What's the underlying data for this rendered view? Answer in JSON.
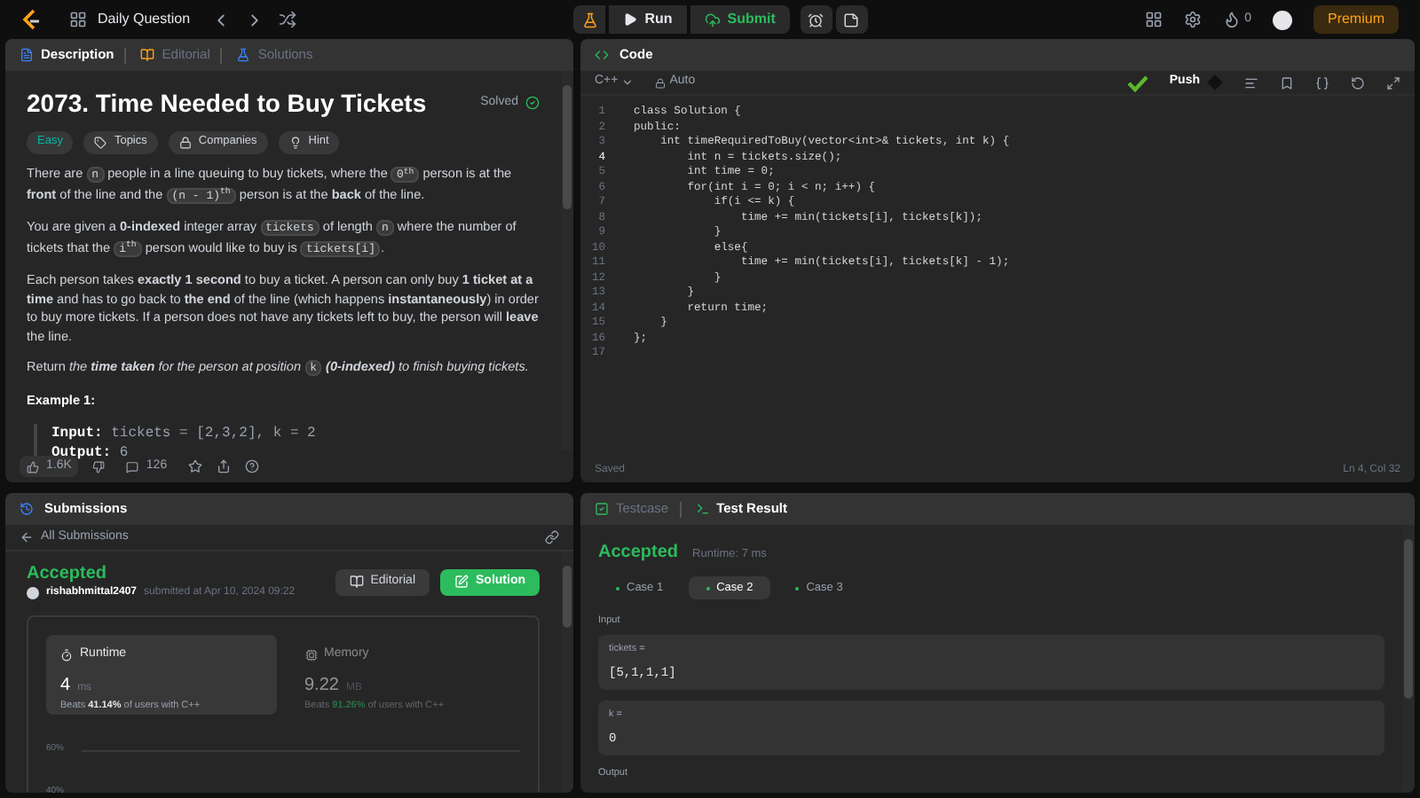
{
  "topbar": {
    "title": "Daily Question",
    "run": "Run",
    "submit": "Submit",
    "streak": "0",
    "premium": "Premium"
  },
  "description": {
    "tabs": [
      {
        "label": "Description",
        "selected": true
      },
      {
        "label": "Editorial",
        "selected": false
      },
      {
        "label": "Solutions",
        "selected": false
      }
    ],
    "title": "2073. Time Needed to Buy Tickets",
    "status": "Solved",
    "chips": [
      {
        "label": "Easy",
        "kind": "difficulty"
      },
      {
        "label": "Topics",
        "kind": "tag"
      },
      {
        "label": "Companies",
        "kind": "lock"
      },
      {
        "label": "Hint",
        "kind": "bulb"
      }
    ],
    "paragraphs": [
      [
        {
          "kind": "text",
          "text": "There are "
        },
        {
          "kind": "code",
          "text": "n"
        },
        {
          "kind": "text",
          "text": " people in a line queuing to buy tickets, where the "
        },
        {
          "kind": "code",
          "text": "0$^{th}$"
        },
        {
          "kind": "text",
          "text": " person is at the **front** of the line and the "
        },
        {
          "kind": "code",
          "text": "(n - 1)$^{th}$"
        },
        {
          "kind": "text",
          "text": " person is at the **back** of the line."
        }
      ],
      [
        {
          "kind": "text",
          "text": "You are given a **0-indexed** integer array "
        },
        {
          "kind": "code",
          "text": "tickets"
        },
        {
          "kind": "text",
          "text": " of length "
        },
        {
          "kind": "code",
          "text": "n"
        },
        {
          "kind": "text",
          "text": " where the number of tickets that the "
        },
        {
          "kind": "code",
          "text": "i$^{th}$"
        },
        {
          "kind": "text",
          "text": " person would like to buy is "
        },
        {
          "kind": "code",
          "text": "tickets[i]"
        },
        {
          "kind": "text",
          "text": "."
        }
      ],
      [
        {
          "kind": "text",
          "text": "Each person takes **exactly 1 second** to buy a ticket. A person can only buy **1 ticket at a time** and has to go back to **the end** of the line (which happens **instantaneously**) in order to buy more tickets. If a person does not have any tickets left to buy, the person will **leave** the line."
        }
      ],
      [
        {
          "kind": "text",
          "text": "Return "
        },
        {
          "kind": "em",
          "text": "the **time taken** for the person at position "
        },
        {
          "kind": "code",
          "text": "k"
        },
        {
          "kind": "em",
          "text": " **(0-indexed)** to finish buying tickets."
        }
      ]
    ],
    "example": {
      "title": "Example 1:",
      "lines": [
        {
          "label": "Input:",
          "value": "tickets = [2,3,2], k = 2"
        },
        {
          "label": "Output:",
          "value": "6"
        }
      ]
    },
    "footer": {
      "likes": "1.6K",
      "comments": "126"
    }
  },
  "code": {
    "title": "Code",
    "language": "C++",
    "mode": "Auto",
    "push": "Push",
    "lines": [
      {
        "number": "1",
        "text": "class Solution {",
        "selected": false
      },
      {
        "number": "2",
        "text": "public:",
        "selected": false
      },
      {
        "number": "3",
        "text": "    int timeRequiredToBuy(vector<int>& tickets, int k) {",
        "selected": false
      },
      {
        "number": "4",
        "text": "        int n = tickets.size();",
        "selected": true
      },
      {
        "number": "5",
        "text": "        int time = 0;",
        "selected": false
      },
      {
        "number": "6",
        "text": "        for(int i = 0; i < n; i++) {",
        "selected": false
      },
      {
        "number": "7",
        "text": "            if(i <= k) {",
        "selected": false
      },
      {
        "number": "8",
        "text": "                time += min(tickets[i], tickets[k]);",
        "selected": false
      },
      {
        "number": "9",
        "text": "            }",
        "selected": false
      },
      {
        "number": "10",
        "text": "            else{",
        "selected": false
      },
      {
        "number": "11",
        "text": "                time += min(tickets[i], tickets[k] - 1);",
        "selected": false
      },
      {
        "number": "12",
        "text": "            }",
        "selected": false
      },
      {
        "number": "13",
        "text": "        }",
        "selected": false
      },
      {
        "number": "14",
        "text": "        return time;",
        "selected": false
      },
      {
        "number": "15",
        "text": "    }",
        "selected": false
      },
      {
        "number": "16",
        "text": "};",
        "selected": false
      },
      {
        "number": "17",
        "selected": false
      }
    ],
    "saved": "Saved",
    "cursor": "Ln 4, Col 32"
  },
  "submissions": {
    "title": "Submissions",
    "back": "All Submissions",
    "status": "Accepted",
    "user": "rishabhmittal2407",
    "submitted": "submitted at Apr 10, 2024 09:22",
    "editorial": "Editorial",
    "solution": "Solution",
    "stats": [
      {
        "label": "Runtime",
        "kind": "clock",
        "value": "4",
        "unit": "ms",
        "beats_prefix": "Beats ",
        "beats": "41.14%",
        "beats_suffix": " of users with C++",
        "selected": true
      },
      {
        "label": "Memory",
        "kind": "chip",
        "value": "9.22",
        "unit": "MB",
        "beats_prefix": "Beats ",
        "beats": "91.26%",
        "beats_suffix": " of users with C++",
        "selected": false
      }
    ],
    "axis_labels": [
      "60%",
      "40%"
    ]
  },
  "result": {
    "tabs": [
      {
        "label": "Testcase",
        "selected": false
      },
      {
        "label": "Test Result",
        "selected": true
      }
    ],
    "status": "Accepted",
    "runtime": "Runtime: 7 ms",
    "cases": [
      {
        "label": "Case 1",
        "selected": false
      },
      {
        "label": "Case 2",
        "selected": true
      },
      {
        "label": "Case 3",
        "selected": false
      }
    ],
    "input_label": "Input",
    "inputs": [
      {
        "name": "tickets =",
        "value": "[5,1,1,1]"
      },
      {
        "name": "k =",
        "value": "0"
      }
    ],
    "output_label": "Output"
  }
}
